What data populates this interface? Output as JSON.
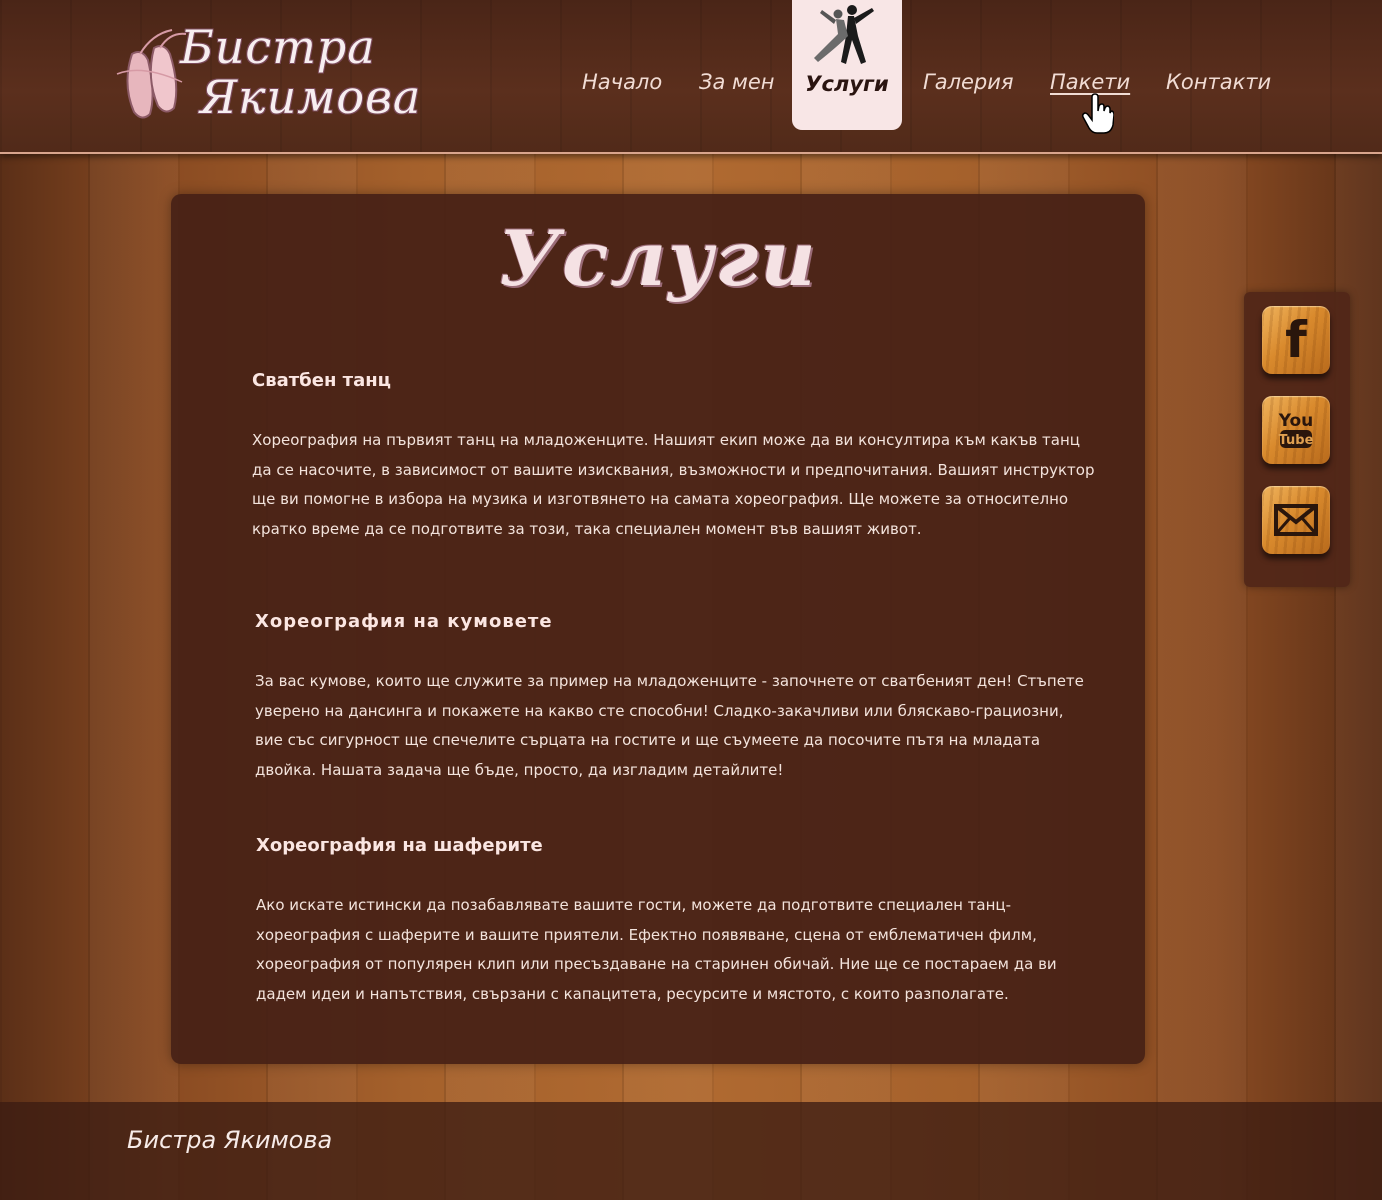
{
  "logo": {
    "line1": "Бистра",
    "line2": "Якимова"
  },
  "nav": {
    "items": [
      {
        "label": "Начало"
      },
      {
        "label": "За мен"
      },
      {
        "label": "Услуги",
        "active": true
      },
      {
        "label": "Галерия"
      },
      {
        "label": "Пакети",
        "hovered": true
      },
      {
        "label": "Контакти"
      }
    ]
  },
  "page": {
    "title": "Услуги"
  },
  "sections": [
    {
      "heading": "Сватбен танц",
      "text": "Хореография на първият танц на младоженците. Нашият екип може да ви консултира към какъв танц да се насочите, в зависимост от вашите изисквания, възможности и предпочитания. Вашият инструктор ще ви помогне в избора на музика и изготвянето на самата хореография. Ще можете за относително кратко време да се подготвите за този, така специален момент във вашият живот."
    },
    {
      "heading": "Хореография на кумовете",
      "text": "За вас кумове, които ще служите за пример на младоженците - започнете от сватбеният ден! Стъпете уверено на дансинга и покажете на какво сте способни! Сладко-закачливи или бляскаво-грациозни, вие със сигурност ще спечелите сърцата на гостите и ще съумеете да посочите пътя на младата двойка. Нашата задача ще бъде, просто, да изгладим детайлите!"
    },
    {
      "heading": "Хореография на шаферите",
      "text": "Ако искате истински да позабавлявате вашите гости, можете да подготвите специален танц-хореография с шаферите и вашите приятели. Ефектно появяване, сцена от емблематичен филм, хореография от популярен клип или пресъздаване на старинен обичай. Ние ще се постараем да ви дадем идеи и напътствия, свързани с капацитета, ресурсите и мястото, с които разполагате."
    }
  ],
  "social": {
    "facebook_icon": "facebook-icon",
    "facebook_glyph": "f",
    "youtube_icon": "youtube-icon",
    "youtube_line1": "You",
    "youtube_line2": "Tube",
    "mail_icon": "mail-icon"
  },
  "footer": {
    "name": "Бистра Якимова"
  },
  "colors": {
    "active_tab_bg": "#f8e6e6",
    "panel_bg": "#46201a",
    "text": "#f3e3dc"
  }
}
